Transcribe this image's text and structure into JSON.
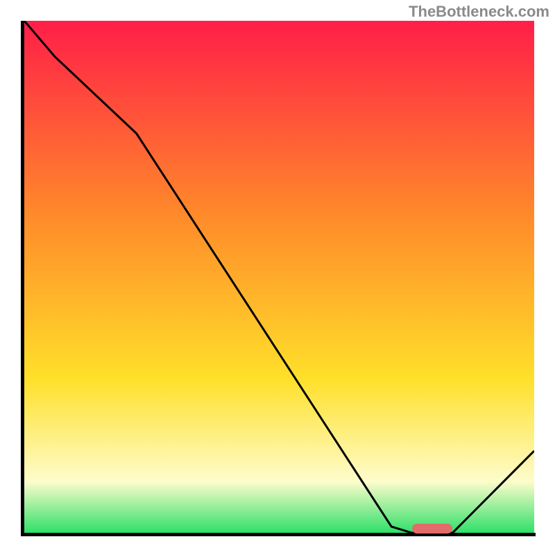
{
  "watermark": "TheBottleneck.com",
  "colors": {
    "gradient_top": "#ff1e48",
    "gradient_upper_mid": "#ff8a2a",
    "gradient_mid": "#ffe02a",
    "gradient_lower_mid": "#fdfccb",
    "gradient_bottom": "#2fe06a",
    "axis": "#000000",
    "curve": "#000000",
    "indicator": "#e36b6b"
  },
  "chart_data": {
    "type": "line",
    "x": [
      0.0,
      0.06,
      0.22,
      0.72,
      0.76,
      0.84,
      1.0
    ],
    "values": [
      1.0,
      0.93,
      0.78,
      0.012,
      0.0,
      0.0,
      0.16
    ],
    "title": "",
    "xlabel": "",
    "ylabel": "",
    "xlim": [
      0,
      1
    ],
    "ylim": [
      0,
      1
    ],
    "indicator": {
      "x_start": 0.76,
      "x_end": 0.84,
      "y": 0.008
    }
  }
}
